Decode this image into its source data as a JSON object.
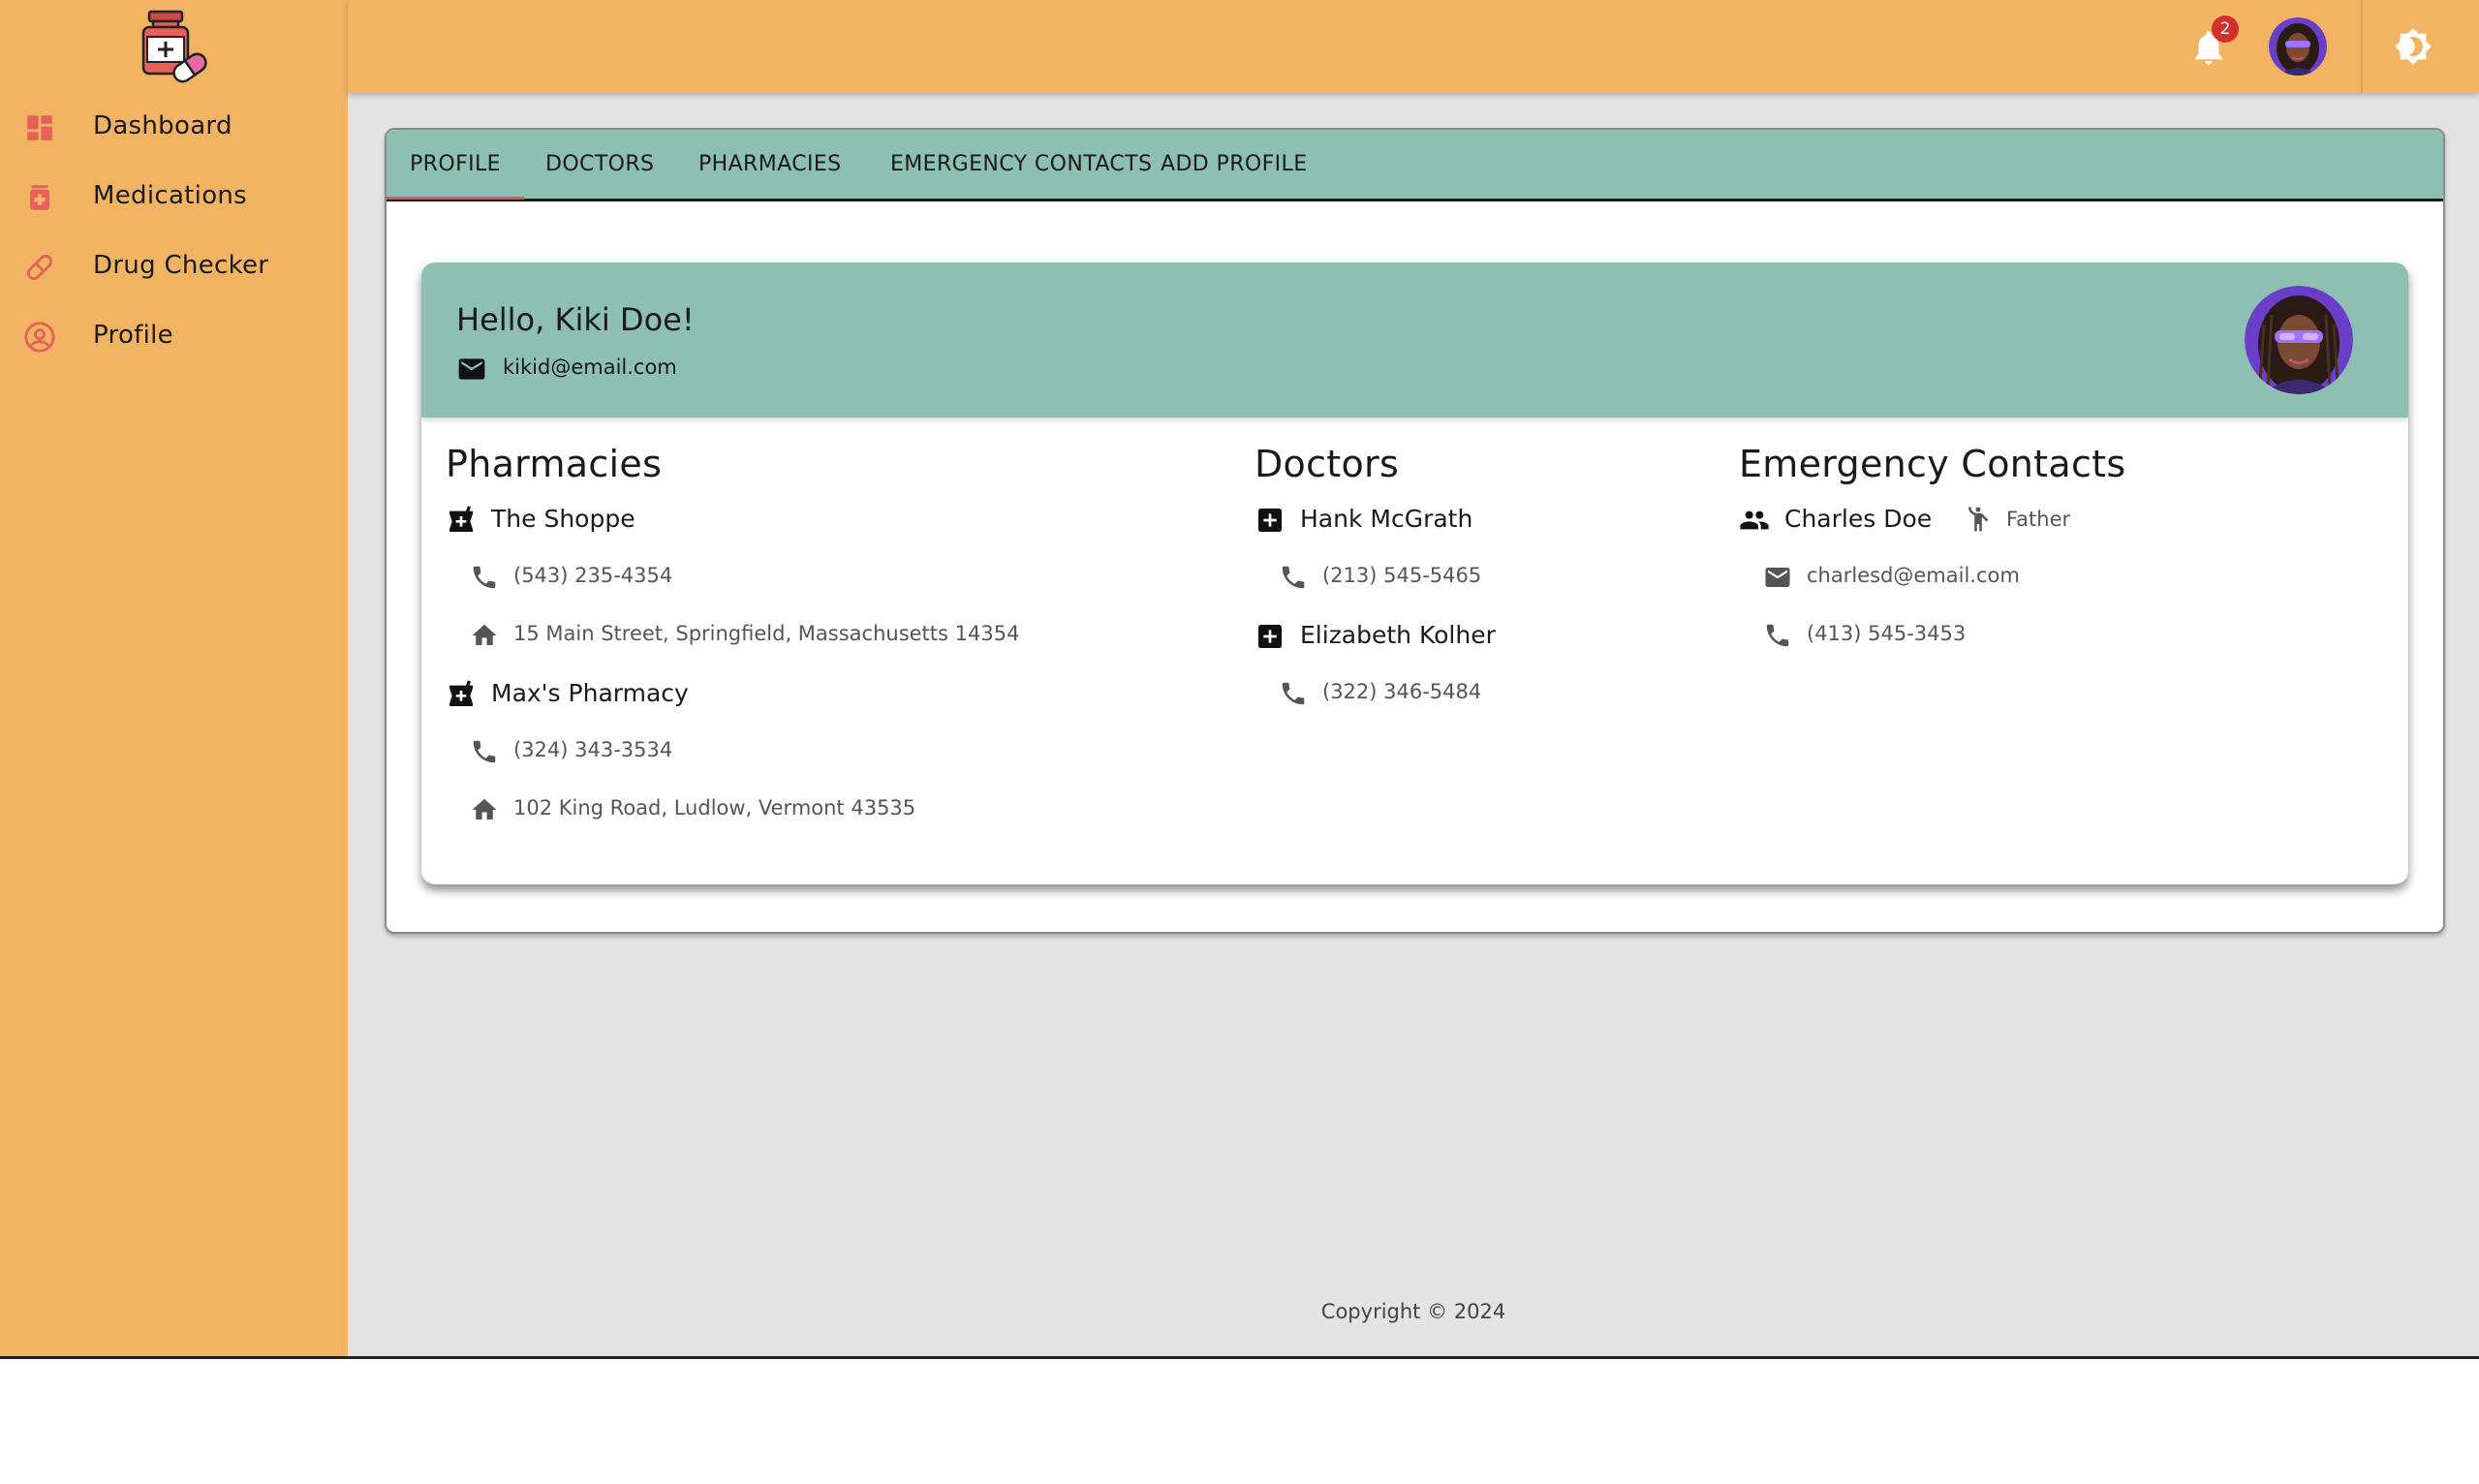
{
  "sidebar": {
    "logo_icon": "medicine-bottle-pill-icon",
    "items": [
      {
        "label": "Dashboard",
        "icon": "dashboard-icon"
      },
      {
        "label": "Medications",
        "icon": "medication-icon"
      },
      {
        "label": "Drug Checker",
        "icon": "pill-icon"
      },
      {
        "label": "Profile",
        "icon": "account-circle-icon"
      }
    ]
  },
  "topbar": {
    "notifications_count": "2",
    "notification_icon": "bell-icon",
    "theme_icon": "brightness-icon"
  },
  "tabs": [
    {
      "label": "PROFILE",
      "active": true
    },
    {
      "label": "DOCTORS"
    },
    {
      "label": "PHARMACIES"
    },
    {
      "label": "EMERGENCY CONTACTS"
    },
    {
      "label": "ADD PROFILE"
    }
  ],
  "profile": {
    "greeting": "Hello, Kiki Doe!",
    "email": "kikid@email.com"
  },
  "pharmacies": {
    "title": "Pharmacies",
    "items": [
      {
        "name": "The Shoppe",
        "phone": "(543) 235-4354",
        "address": "15 Main Street, Springfield, Massachusetts 14354"
      },
      {
        "name": "Max's Pharmacy",
        "phone": "(324) 343-3534",
        "address": "102 King Road, Ludlow, Vermont 43535"
      }
    ]
  },
  "doctors": {
    "title": "Doctors",
    "items": [
      {
        "name": "Hank McGrath",
        "phone": "(213) 545-5465"
      },
      {
        "name": "Elizabeth Kolher",
        "phone": "(322) 346-5484"
      }
    ]
  },
  "emergency_contacts": {
    "title": "Emergency Contacts",
    "items": [
      {
        "name": "Charles Doe",
        "relation": "Father",
        "email": "charlesd@email.com",
        "phone": "(413) 545-3453"
      }
    ]
  },
  "footer": {
    "text": "Copyright © 2024"
  },
  "colors": {
    "sidebar_bg": "#f2b462",
    "accent_teal": "#8ebfb3",
    "nav_icon": "#e8605a",
    "badge": "#d32f2f",
    "content_bg": "#e4e4e4"
  }
}
